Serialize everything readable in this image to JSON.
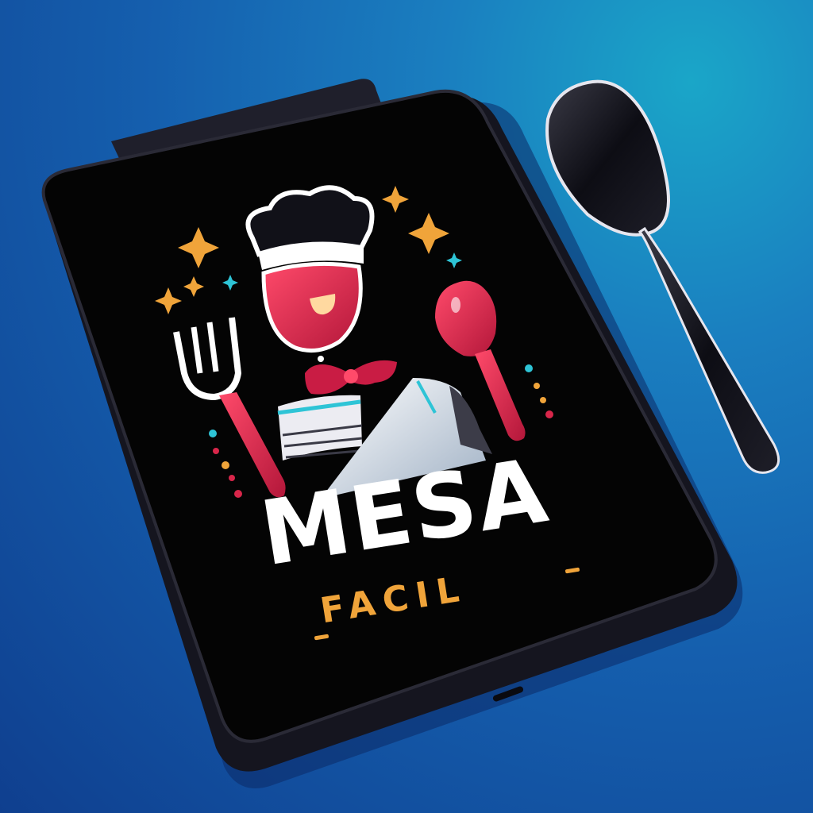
{
  "logo": {
    "title": "MESA",
    "subtitle": "FACIL"
  },
  "colors": {
    "background": "#1572b8",
    "tablet": "#050505",
    "accent_red": "#d8264a",
    "accent_gold": "#f0a43a",
    "accent_cyan": "#2ec4d6",
    "spoon": "#14141c"
  },
  "icons": [
    "tablet-icon",
    "spoon-icon",
    "chef-hat-icon",
    "wine-glass-icon",
    "fork-icon",
    "spoon-icon",
    "bow-tie-icon",
    "knife-icon",
    "sparkle-icon"
  ]
}
